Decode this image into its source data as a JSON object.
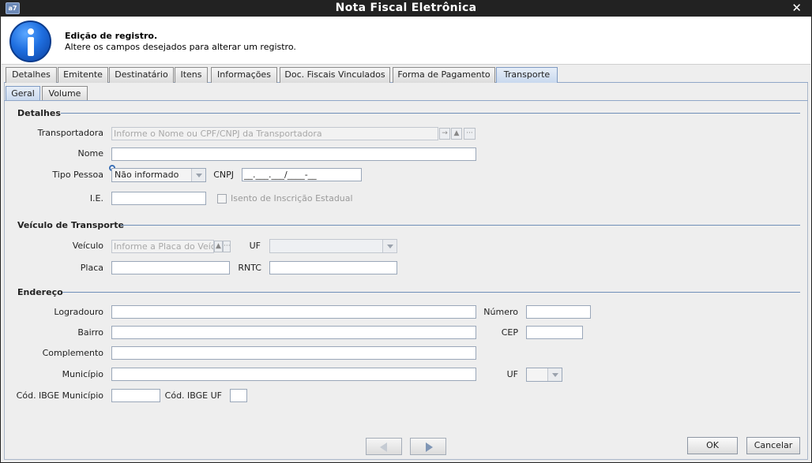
{
  "window": {
    "title": "Nota Fiscal Eletrônica",
    "app_icon_text": "a7",
    "close_glyph": "✕"
  },
  "header": {
    "icon": "info-icon",
    "title": "Edição de registro.",
    "subtitle": "Altere os campos desejados para alterar um registro."
  },
  "tabs": [
    "Detalhes",
    "Emitente",
    "Destinatário",
    "Itens",
    "Informações",
    "Doc. Fiscais Vinculados",
    "Forma de Pagamento",
    "Transporte"
  ],
  "active_tab": "Transporte",
  "subtabs": [
    "Geral",
    "Volume"
  ],
  "active_subtab": "Geral",
  "sections": {
    "detalhes": {
      "title": "Detalhes",
      "transportadora_label": "Transportadora",
      "transportadora_placeholder": "Informe o Nome ou CPF/CNPJ da Transportadora",
      "nome_label": "Nome",
      "nome_value": "",
      "tipo_pessoa_label": "Tipo Pessoa",
      "tipo_pessoa_value": "Não informado",
      "cnpj_label": "CNPJ",
      "cnpj_value": "__.___.___/____-__",
      "ie_label": "I.E.",
      "ie_value": "",
      "isento_label": "Isento de Inscrição Estadual",
      "isento_checked": false
    },
    "veiculo": {
      "title": "Veículo de Transporte",
      "veiculo_label": "Veículo",
      "veiculo_placeholder": "Informe a Placa do Veículo",
      "uf_label": "UF",
      "uf_value": "",
      "placa_label": "Placa",
      "placa_value": "",
      "rntc_label": "RNTC",
      "rntc_value": ""
    },
    "endereco": {
      "title": "Endereço",
      "logradouro_label": "Logradouro",
      "logradouro_value": "",
      "numero_label": "Número",
      "numero_value": "",
      "bairro_label": "Bairro",
      "bairro_value": "",
      "cep_label": "CEP",
      "cep_value": "",
      "complemento_label": "Complemento",
      "complemento_value": "",
      "municipio_label": "Município",
      "municipio_value": "",
      "uf_label": "UF",
      "uf_value": "",
      "cod_ibge_municipio_label": "Cód. IBGE Município",
      "cod_ibge_municipio_value": "",
      "cod_ibge_uf_label": "Cód. IBGE UF",
      "cod_ibge_uf_value": ""
    }
  },
  "buttons": {
    "ok": "OK",
    "cancel": "Cancelar",
    "prev_icon": "left-arrow-icon",
    "next_icon": "right-arrow-icon"
  },
  "lookup_icons": {
    "go": "→",
    "up": "▲",
    "more": "···"
  }
}
